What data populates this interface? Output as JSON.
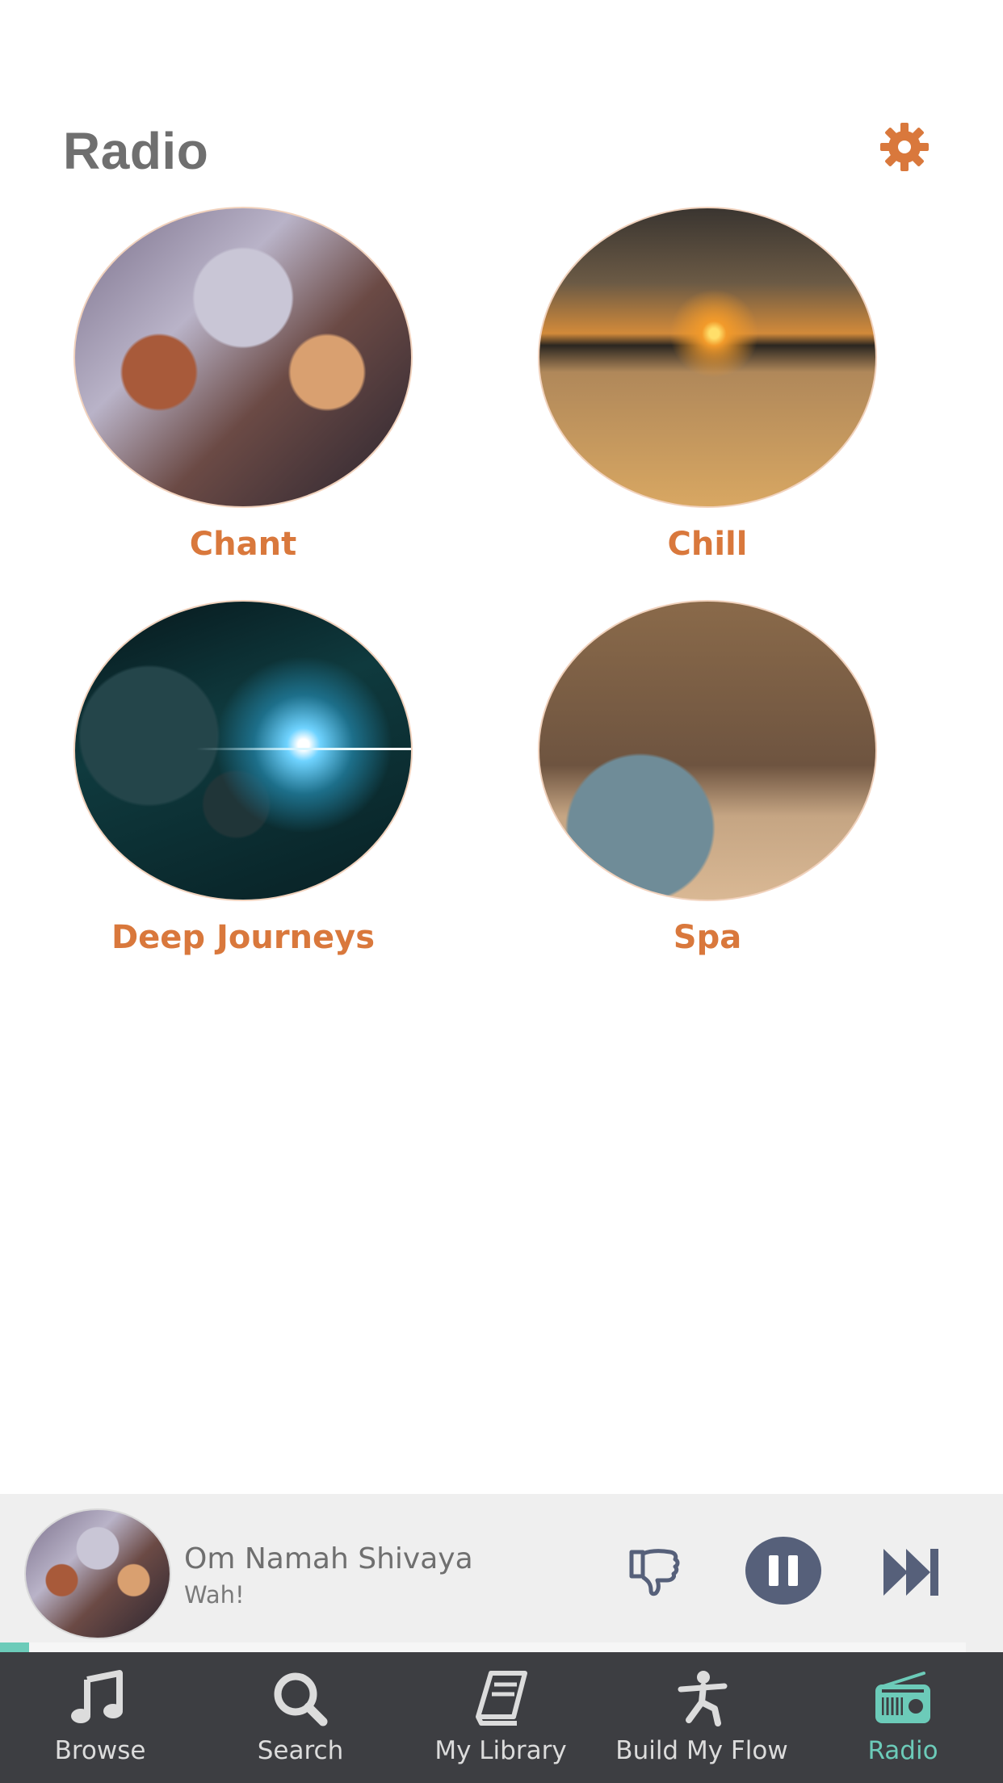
{
  "header": {
    "title": "Radio",
    "settings_icon": "gear-icon"
  },
  "accent_color": "#d9783c",
  "active_color": "#6ccbb9",
  "stations": [
    {
      "label": "Chant"
    },
    {
      "label": "Chill"
    },
    {
      "label": "Deep Journeys"
    },
    {
      "label": "Spa"
    }
  ],
  "player": {
    "title": "Om Namah Shivaya",
    "artist": "Wah!",
    "progress": 0.03,
    "controls": [
      "thumbs-down-icon",
      "pause-icon",
      "skip-next-icon"
    ]
  },
  "tabs": [
    {
      "label": "Browse",
      "icon": "music-note-icon"
    },
    {
      "label": "Search",
      "icon": "search-icon"
    },
    {
      "label": "My Library",
      "icon": "book-icon"
    },
    {
      "label": "Build My Flow",
      "icon": "yoga-figure-icon"
    },
    {
      "label": "Radio",
      "icon": "radio-icon",
      "active": true
    }
  ]
}
